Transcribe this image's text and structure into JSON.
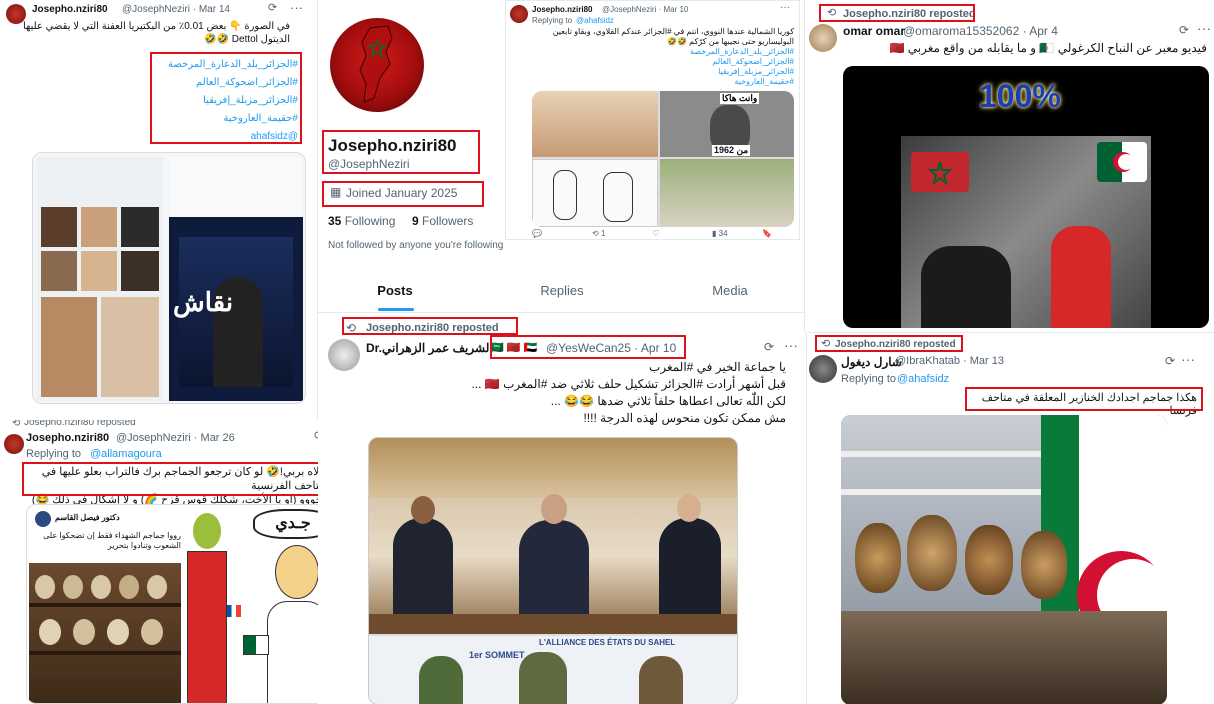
{
  "profile": {
    "display_name": "Josepho.nziri80",
    "handle": "@JosephNeziri",
    "joined": "Joined January 2025",
    "following_count": "35",
    "following_label": "Following",
    "followers_count": "9",
    "followers_label": "Followers",
    "not_followed": "Not followed by anyone you're following",
    "tabs": [
      "Posts",
      "Replies",
      "Media"
    ]
  },
  "post1": {
    "name": "Josepho.nziri80",
    "handle_date": "@JosephNeziri · Mar 14",
    "text": "في الصورة 👇 بعض 0.01٪ من البكتيريا العفنة التي لا يقضي عليها الديتول Dettol 🤣🤣",
    "hashtags": [
      "#الجزائر_بلد_الدعارة_المرخصة",
      "#الجزائر_اضحوكة_العالم",
      "#الجزائر_مزبلة_إفريقيا",
      "#حقيمة_العاروخية"
    ],
    "mention": "@ahafsidz",
    "image_caption": "نقاش"
  },
  "post2": {
    "name": "Josepho.nziri80",
    "handle_date": "@JosephNeziri · Mar 10",
    "replying_label": "Replying to",
    "replying_to": "@ahafsidz",
    "text": "كوريا الشمالية عندها النووي، انتم في #الجزائر عندكم القلاوي، وبقاو تابعين البوليساريو حتى نجيبها من كرّكم 🤣🤣",
    "hashtags": [
      "#الجزائر_بلد_الدعارة_المرخصة",
      "#الجزائر_اضحوكة_العالم",
      "#الجزائر_مزبلة_إفريقيا",
      "#حقيمة_العاروخية"
    ],
    "img_label1": "وانت هاكا",
    "img_label2": "من 1962",
    "stats": [
      "1",
      "",
      "34",
      ""
    ]
  },
  "retweet_omar": {
    "reposted_label": "Josepho.nziri80 reposted",
    "name": "omar omar",
    "handle_date": "@omaroma15352062 · Apr 4",
    "text": "فيديو معبر عن النباح الكرغولي 🇩🇿 و ما يقابله من واقع مغربي 🇲🇦",
    "video_text": "100%"
  },
  "retweet_zahrani": {
    "reposted_label": "Josepho.nziri80 reposted",
    "name": "Dr.الشريف عمر الزهراني",
    "flags": "🇸🇦 🇲🇦 🇦🇪",
    "handle_date": "@YesWeCan25 · Apr 10",
    "line1": "يا جماعة الخير في #المغرب",
    "line2": "قبل أشهر أرادت #الجزائر  تشكيل حلف ثلاثي ضد #المغرب 🇲🇦 ...",
    "line3": "لكن اللّٰه تعالى اعطاها حلفاً ثلاثي ضدها 😂😂 ...",
    "line4": "مش ممكن تكون منحوس لهذه الدرجة !!!!",
    "banner_text": "L'ALLIANCE DES ÉTATS DU SAHEL",
    "banner_sub": "1er SOMMET"
  },
  "retweet_charl": {
    "reposted_label": "Josepho.nziri80 reposted",
    "name": "شارل ديغول",
    "handle_date": "@IbraKhatab · Mar 13",
    "replying_label": "Replying to",
    "replying_to": "@ahafsidz",
    "text": "هكذا جماجم اجدادك الخنازير المعلقة في متاحف فرنسا"
  },
  "post_bottom_left": {
    "reposted_label": "Josepho.nziri80 reposted",
    "name": "Josepho.nziri80",
    "handle_date": "@JosephNeziri · Mar 26",
    "replying_label": "Replying to",
    "replying_to": "@allamagoura",
    "text1": "شالاه بربي!🤣 لو كان ترجعو الجماجم برك فالتراب بعلو عليها في المتاحف الفرنسية",
    "text2": "يا خووو (او يا الأخت، شكلك قوس قزح 🌈) و لا إشكال في ذلك 😂)",
    "quoted_name": "دكتور فيصل القاسم",
    "quoted_text": "رووا جماجم الشهداء فقط إن تضحكوا على الشعوب وتنادوا بتحرير",
    "cartoon_text": "جـدي"
  },
  "colors": {
    "highlight": "#e0101a",
    "link": "#1d9bf0",
    "muted": "#536471"
  }
}
